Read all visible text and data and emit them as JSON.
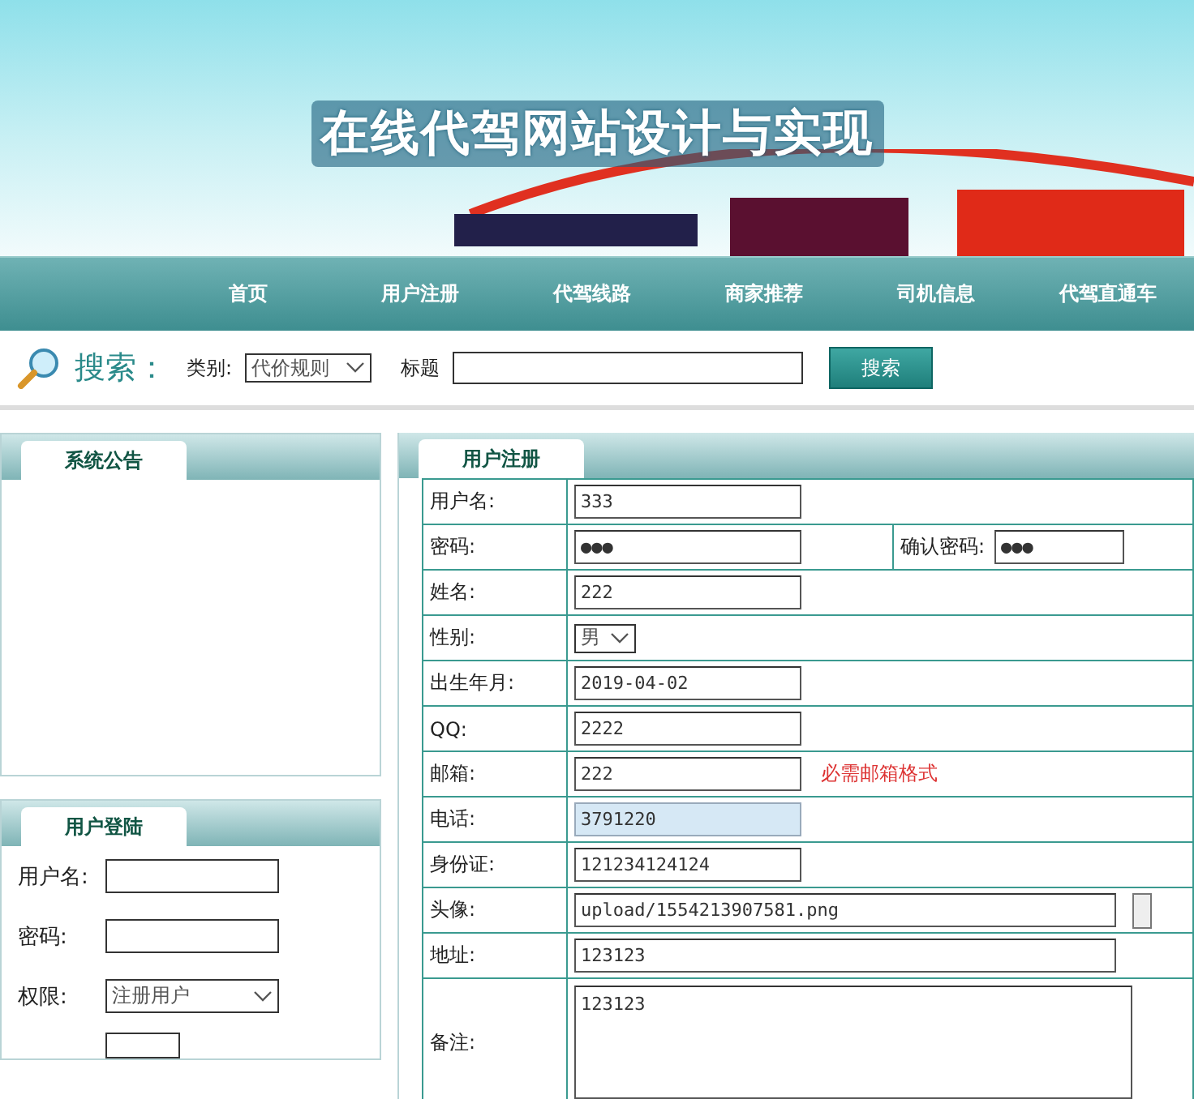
{
  "banner": {
    "title": "在线代驾网站设计与实现"
  },
  "nav": [
    {
      "label": "首页"
    },
    {
      "label": "用户注册"
    },
    {
      "label": "代驾线路"
    },
    {
      "label": "商家推荐"
    },
    {
      "label": "司机信息"
    },
    {
      "label": "代驾直通车"
    }
  ],
  "search": {
    "heading": "搜索：",
    "category_label": "类别:",
    "category_value": "代价规则",
    "title_label": "标题",
    "button": "搜索"
  },
  "notice_panel": {
    "title": "系统公告"
  },
  "login_panel": {
    "title": "用户登陆",
    "fields": [
      {
        "kind": "text",
        "label": "用户名:"
      },
      {
        "kind": "password",
        "label": "密码:"
      },
      {
        "kind": "select",
        "label": "权限:",
        "value": "注册用户"
      }
    ]
  },
  "register_panel": {
    "title": "用户注册",
    "rows": [
      {
        "kind": "text",
        "label": "用户名:",
        "value": "333",
        "focused": false
      },
      {
        "kind": "password",
        "label": "密码:",
        "value": "●●●",
        "focused": false,
        "extra_label": "确认密码:",
        "extra_value": "●●●"
      },
      {
        "kind": "text",
        "label": "姓名:",
        "value": "222",
        "focused": false
      },
      {
        "kind": "select",
        "label": "性别:",
        "value": "男",
        "focused": false
      },
      {
        "kind": "text",
        "label": "出生年月:",
        "value": "2019-04-02",
        "focused": false
      },
      {
        "kind": "text",
        "label": "QQ:",
        "value": "2222",
        "focused": false
      },
      {
        "kind": "text",
        "label": "邮箱:",
        "value": "222",
        "focused": false,
        "hint": "必需邮箱格式"
      },
      {
        "kind": "text",
        "label": "电话:",
        "value": "3791220",
        "focused": true
      },
      {
        "kind": "text",
        "label": "身份证:",
        "value": "121234124124",
        "focused": false
      },
      {
        "kind": "file",
        "label": "头像:",
        "value": "upload/1554213907581.png",
        "focused": false
      },
      {
        "kind": "wide",
        "label": "地址:",
        "value": "123123",
        "focused": false
      },
      {
        "kind": "textarea",
        "label": "备注:",
        "value": "123123",
        "focused": false
      }
    ]
  }
}
